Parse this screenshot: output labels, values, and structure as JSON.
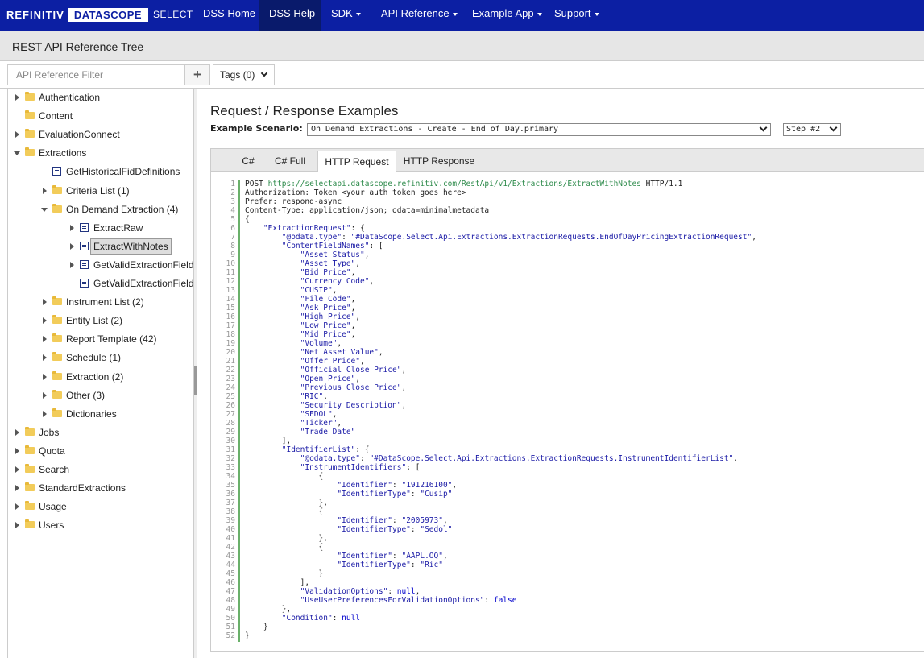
{
  "brand": {
    "refinitiv": "REFINITIV",
    "datascope": "DATASCOPE",
    "select": "SELECT"
  },
  "nav": [
    {
      "label": "DSS Home",
      "dropdown": false,
      "active": false
    },
    {
      "label": "DSS Help",
      "dropdown": false,
      "active": true
    },
    {
      "label": "SDK",
      "dropdown": true,
      "active": false
    },
    {
      "label": "API Reference",
      "dropdown": true,
      "active": false
    },
    {
      "label": "Example App",
      "dropdown": true,
      "active": false
    },
    {
      "label": "Support",
      "dropdown": true,
      "active": false
    }
  ],
  "subheader": {
    "title": "REST API Reference Tree"
  },
  "filter": {
    "placeholder": "API Reference Filter",
    "add": "+",
    "tags": "Tags (0)"
  },
  "tree": [
    {
      "label": "Authentication",
      "level": 0,
      "arrow": "right",
      "icon": "folder"
    },
    {
      "label": "Content",
      "level": 0,
      "arrow": "none",
      "icon": "folder"
    },
    {
      "label": "EvaluationConnect",
      "level": 0,
      "arrow": "right",
      "icon": "folder"
    },
    {
      "label": "Extractions",
      "level": 0,
      "arrow": "down",
      "icon": "folder"
    },
    {
      "label": "GetHistoricalFidDefinitions",
      "level": 1,
      "arrow": "none",
      "icon": "doc"
    },
    {
      "label": "Criteria List (1)",
      "level": 1,
      "arrow": "right",
      "icon": "folder"
    },
    {
      "label": "On Demand Extraction (4)",
      "level": 1,
      "arrow": "down",
      "icon": "folder"
    },
    {
      "label": "ExtractRaw",
      "level": 2,
      "arrow": "right",
      "icon": "doc"
    },
    {
      "label": "ExtractWithNotes",
      "level": 2,
      "arrow": "right",
      "icon": "doc",
      "selected": true
    },
    {
      "label": "GetValidExtractionFieldTypes",
      "level": 2,
      "arrow": "right",
      "icon": "doc"
    },
    {
      "label": "GetValidExtractionFieldTypesByTemplateName",
      "level": 2,
      "arrow": "none",
      "icon": "doc"
    },
    {
      "label": "Instrument List (2)",
      "level": 1,
      "arrow": "right",
      "icon": "folder"
    },
    {
      "label": "Entity List (2)",
      "level": 1,
      "arrow": "right",
      "icon": "folder"
    },
    {
      "label": "Report Template (42)",
      "level": 1,
      "arrow": "right",
      "icon": "folder"
    },
    {
      "label": "Schedule (1)",
      "level": 1,
      "arrow": "right",
      "icon": "folder"
    },
    {
      "label": "Extraction (2)",
      "level": 1,
      "arrow": "right",
      "icon": "folder"
    },
    {
      "label": "Other (3)",
      "level": 1,
      "arrow": "right",
      "icon": "folder"
    },
    {
      "label": "Dictionaries",
      "level": 1,
      "arrow": "right",
      "icon": "folder"
    },
    {
      "label": "Jobs",
      "level": 0,
      "arrow": "right",
      "icon": "folder"
    },
    {
      "label": "Quota",
      "level": 0,
      "arrow": "right",
      "icon": "folder"
    },
    {
      "label": "Search",
      "level": 0,
      "arrow": "right",
      "icon": "folder"
    },
    {
      "label": "StandardExtractions",
      "level": 0,
      "arrow": "right",
      "icon": "folder"
    },
    {
      "label": "Usage",
      "level": 0,
      "arrow": "right",
      "icon": "folder"
    },
    {
      "label": "Users",
      "level": 0,
      "arrow": "right",
      "icon": "folder"
    }
  ],
  "main": {
    "title": "Request / Response Examples",
    "scenario_label": "Example Scenario:",
    "scenario_value": "On Demand Extractions - Create - End of Day.primary",
    "step_value": "Step #2",
    "tabs": [
      {
        "label": "C#",
        "active": false
      },
      {
        "label": "C# Full",
        "active": false
      },
      {
        "label": "HTTP Request",
        "active": true
      },
      {
        "label": "HTTP Response",
        "active": false
      }
    ]
  },
  "code_lines": [
    "POST https://selectapi.datascope.refinitiv.com/RestApi/v1/Extractions/ExtractWithNotes HTTP/1.1",
    "Authorization: Token <your_auth_token_goes_here>",
    "Prefer: respond-async",
    "Content-Type: application/json; odata=minimalmetadata",
    "{",
    "    \"ExtractionRequest\": {",
    "        \"@odata.type\": \"#DataScope.Select.Api.Extractions.ExtractionRequests.EndOfDayPricingExtractionRequest\",",
    "        \"ContentFieldNames\": [",
    "            \"Asset Status\",",
    "            \"Asset Type\",",
    "            \"Bid Price\",",
    "            \"Currency Code\",",
    "            \"CUSIP\",",
    "            \"File Code\",",
    "            \"Ask Price\",",
    "            \"High Price\",",
    "            \"Low Price\",",
    "            \"Mid Price\",",
    "            \"Volume\",",
    "            \"Net Asset Value\",",
    "            \"Offer Price\",",
    "            \"Official Close Price\",",
    "            \"Open Price\",",
    "            \"Previous Close Price\",",
    "            \"RIC\",",
    "            \"Security Description\",",
    "            \"SEDOL\",",
    "            \"Ticker\",",
    "            \"Trade Date\"",
    "        ],",
    "        \"IdentifierList\": {",
    "            \"@odata.type\": \"#DataScope.Select.Api.Extractions.ExtractionRequests.InstrumentIdentifierList\",",
    "            \"InstrumentIdentifiers\": [",
    "                {",
    "                    \"Identifier\": \"191216100\",",
    "                    \"IdentifierType\": \"Cusip\"",
    "                },",
    "                {",
    "                    \"Identifier\": \"2005973\",",
    "                    \"IdentifierType\": \"Sedol\"",
    "                },",
    "                {",
    "                    \"Identifier\": \"AAPL.OQ\",",
    "                    \"IdentifierType\": \"Ric\"",
    "                }",
    "            ],",
    "            \"ValidationOptions\": null,",
    "            \"UseUserPreferencesForValidationOptions\": false",
    "        },",
    "        \"Condition\": null",
    "    }",
    "}"
  ],
  "colors": {
    "nav_bg": "#0c1fa3",
    "nav_active": "#091a6b",
    "string": "#1a1aa6",
    "keyword": "#0000cc",
    "url": "#2c8a4a"
  }
}
